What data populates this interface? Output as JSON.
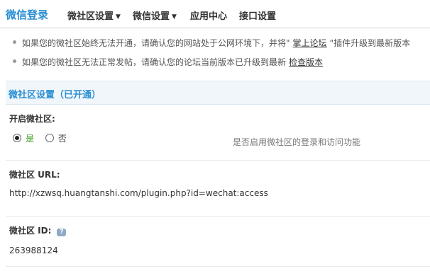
{
  "nav": {
    "brand": "微信登录",
    "items": [
      {
        "label": "微社区设置",
        "caret": "▼"
      },
      {
        "label": "微信设置",
        "caret": "▼"
      },
      {
        "label": "应用中心",
        "caret": ""
      },
      {
        "label": "接口设置",
        "caret": ""
      }
    ]
  },
  "tips": [
    {
      "pre": "如果您的微社区始终无法开通，请确认您的网站处于公网环境下，并将\"",
      "link": "掌上论坛",
      "post": "\"插件升级到最新版本"
    },
    {
      "pre": "如果您的微社区无法正常发帖，请确认您的论坛当前版本已升级到最新",
      "link": "检查版本",
      "post": ""
    }
  ],
  "section": {
    "title": "微社区设置（已开通）"
  },
  "enable": {
    "label": "开启微社区:",
    "options": [
      "是",
      "否"
    ],
    "selected": "是",
    "hint": "是否启用微社区的登录和访问功能"
  },
  "url": {
    "label": "微社区 URL:",
    "value": "http://xzwsq.huangtanshi.com/plugin.php?id=wechat:access"
  },
  "id": {
    "label": "微社区 ID:",
    "help_icon": "?",
    "value": "263988124"
  }
}
